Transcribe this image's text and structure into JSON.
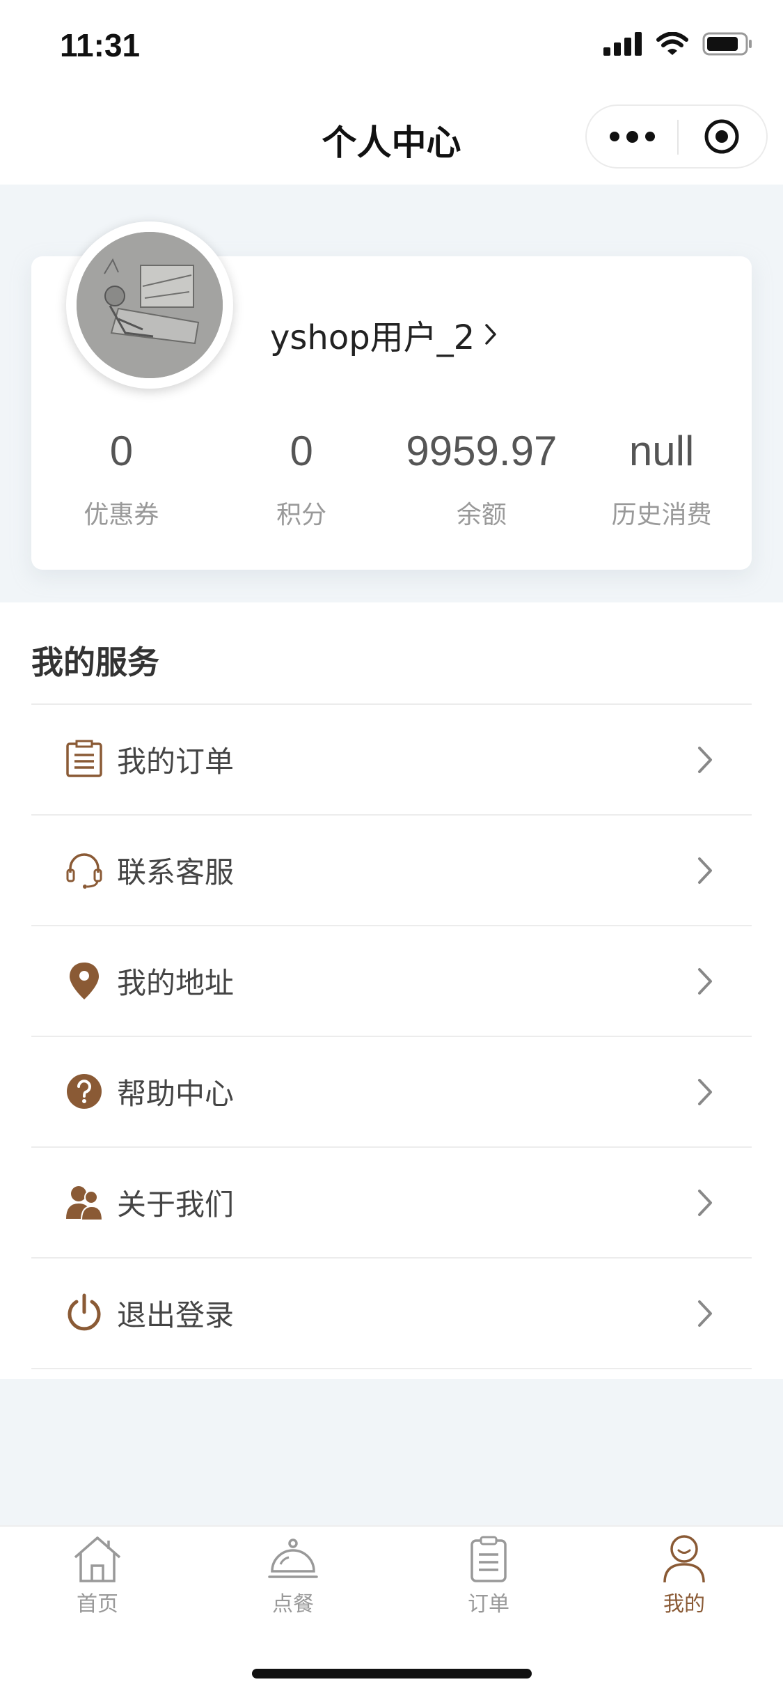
{
  "status_bar": {
    "time": "11:31"
  },
  "nav": {
    "title": "个人中心"
  },
  "profile": {
    "username": "yshop用户_2"
  },
  "stats": [
    {
      "value": "0",
      "label": "优惠券"
    },
    {
      "value": "0",
      "label": "积分"
    },
    {
      "value": "9959.97",
      "label": "余额"
    },
    {
      "value": "null",
      "label": "历史消费"
    }
  ],
  "services": {
    "title": "我的服务",
    "items": [
      {
        "label": "我的订单",
        "icon": "order-list-icon"
      },
      {
        "label": "联系客服",
        "icon": "headset-icon"
      },
      {
        "label": "我的地址",
        "icon": "location-pin-icon"
      },
      {
        "label": "帮助中心",
        "icon": "help-icon"
      },
      {
        "label": "关于我们",
        "icon": "users-icon"
      },
      {
        "label": "退出登录",
        "icon": "power-icon"
      }
    ]
  },
  "tabbar": {
    "items": [
      {
        "label": "首页",
        "icon": "home-icon"
      },
      {
        "label": "点餐",
        "icon": "cloche-icon"
      },
      {
        "label": "订单",
        "icon": "order-icon"
      },
      {
        "label": "我的",
        "icon": "profile-icon",
        "active": true
      }
    ]
  },
  "colors": {
    "accent": "#8a5a35",
    "background": "#f1f5f8"
  }
}
